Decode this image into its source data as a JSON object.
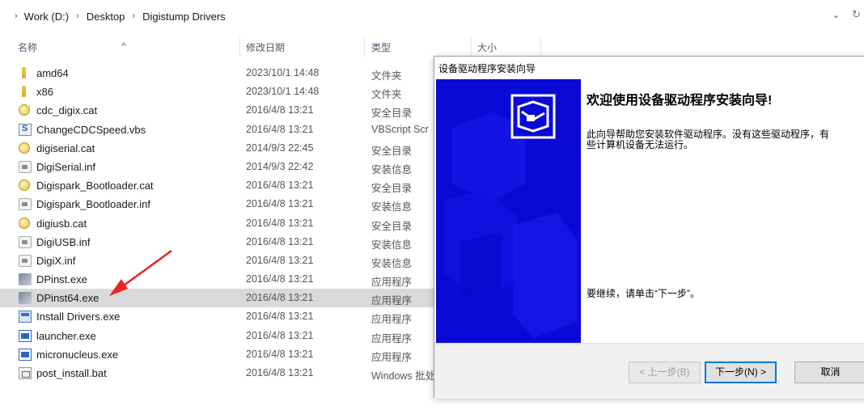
{
  "address": {
    "crumbs": [
      "Work (D:)",
      "Desktop",
      "Digistump Drivers"
    ],
    "separator": "›",
    "leading_separator": "›",
    "dropdown_glyph": "⌄",
    "refresh_glyph": "↻"
  },
  "columns": {
    "name": "名称",
    "date": "修改日期",
    "type": "类型",
    "size": "大小",
    "sort_glyph": "^"
  },
  "files": [
    {
      "name": "amd64",
      "date": "2023/10/1 14:48",
      "type": "文件夹",
      "icon": "folder-icon"
    },
    {
      "name": "x86",
      "date": "2023/10/1 14:48",
      "type": "文件夹",
      "icon": "folder-icon"
    },
    {
      "name": "cdc_digix.cat",
      "date": "2016/4/8 13:21",
      "type": "安全目录",
      "icon": "security-catalog-icon"
    },
    {
      "name": "ChangeCDCSpeed.vbs",
      "date": "2016/4/8 13:21",
      "type": "VBScript Scr",
      "icon": "vbscript-icon"
    },
    {
      "name": "digiserial.cat",
      "date": "2014/9/3 22:45",
      "type": "安全目录",
      "icon": "security-catalog-icon"
    },
    {
      "name": "DigiSerial.inf",
      "date": "2014/9/3 22:42",
      "type": "安装信息",
      "icon": "setup-information-icon"
    },
    {
      "name": "Digispark_Bootloader.cat",
      "date": "2016/4/8 13:21",
      "type": "安全目录",
      "icon": "security-catalog-icon"
    },
    {
      "name": "Digispark_Bootloader.inf",
      "date": "2016/4/8 13:21",
      "type": "安装信息",
      "icon": "setup-information-icon"
    },
    {
      "name": "digiusb.cat",
      "date": "2016/4/8 13:21",
      "type": "安全目录",
      "icon": "security-catalog-icon"
    },
    {
      "name": "DigiUSB.inf",
      "date": "2016/4/8 13:21",
      "type": "安装信息",
      "icon": "setup-information-icon"
    },
    {
      "name": "DigiX.inf",
      "date": "2016/4/8 13:21",
      "type": "安装信息",
      "icon": "setup-information-icon"
    },
    {
      "name": "DPinst.exe",
      "date": "2016/4/8 13:21",
      "type": "应用程序",
      "icon": "installer-exe-icon"
    },
    {
      "name": "DPinst64.exe",
      "date": "2016/4/8 13:21",
      "type": "应用程序",
      "icon": "installer-exe-icon",
      "selected": true
    },
    {
      "name": "Install Drivers.exe",
      "date": "2016/4/8 13:21",
      "type": "应用程序",
      "icon": "install-drivers-icon"
    },
    {
      "name": "launcher.exe",
      "date": "2016/4/8 13:21",
      "type": "应用程序",
      "icon": "application-window-icon"
    },
    {
      "name": "micronucleus.exe",
      "date": "2016/4/8 13:21",
      "type": "应用程序",
      "icon": "application-window-icon"
    },
    {
      "name": "post_install.bat",
      "date": "2016/4/8 13:21",
      "type": "Windows 批处",
      "icon": "batch-file-icon"
    }
  ],
  "dialog": {
    "title": "设备驱动程序安装向导",
    "heading": "欢迎使用设备驱动程序安装向导!",
    "description": "此向导帮助您安装软件驱动程序。没有这些驱动程序，有些计算机设备无法运行。",
    "continue_text": "要继续，请单击“下一步”。",
    "buttons": {
      "back": "< 上一步(B)",
      "next": "下一步(N) >",
      "cancel": "取消"
    },
    "colors": {
      "sidebar": "#0a0ad8",
      "default_button_border": "#0078d7"
    }
  },
  "annotation": {
    "arrow_color": "#e8251f"
  }
}
